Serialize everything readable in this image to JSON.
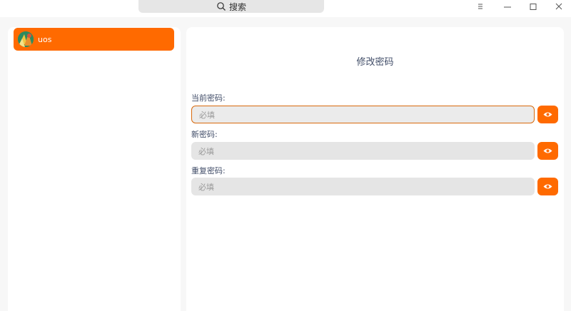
{
  "titlebar": {
    "search_label": "搜索",
    "icons": [
      "search-icon",
      "menu-icon",
      "minimize-icon",
      "maximize-icon",
      "close-icon"
    ]
  },
  "sidebar": {
    "users": [
      {
        "name": "uos",
        "selected": true
      }
    ]
  },
  "main": {
    "title": "修改密码",
    "fields": [
      {
        "label": "当前密码:",
        "placeholder": "必填",
        "focused": true
      },
      {
        "label": "新密码:",
        "placeholder": "必填",
        "focused": false
      },
      {
        "label": "重复密码:",
        "placeholder": "必填",
        "focused": false
      }
    ]
  },
  "colors": {
    "accent": "#ff6a00",
    "focus_border": "#d8690c",
    "input_bg": "#e5e5e5",
    "window_bg": "#f7f7f7"
  }
}
